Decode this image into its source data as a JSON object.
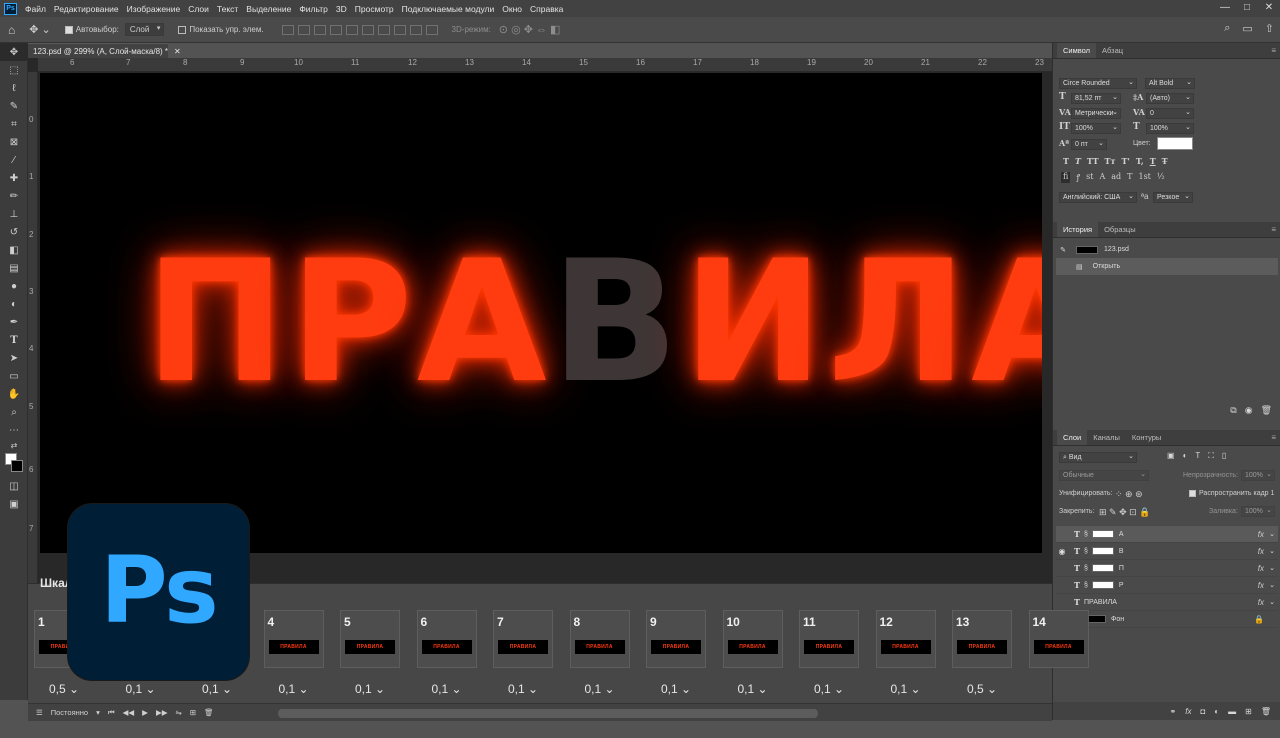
{
  "app": {
    "logo": "Ps"
  },
  "menu": [
    "Файл",
    "Редактирование",
    "Изображение",
    "Слои",
    "Текст",
    "Выделение",
    "Фильтр",
    "3D",
    "Просмотр",
    "Подключаемые модули",
    "Окно",
    "Справка"
  ],
  "window_buttons": [
    "—",
    "□",
    "✕"
  ],
  "options": {
    "auto_select_label": "Автовыбор:",
    "auto_select_value": "Слой",
    "show_transform_label": "Показать упр. элем.",
    "mode_3d_label": "3D-режим:"
  },
  "document": {
    "tab_title": "123.psd @ 299% (А, Слой-маска/8) *",
    "ruler_top": [
      "6",
      "7",
      "8",
      "9",
      "10",
      "11",
      "12",
      "13",
      "14",
      "15",
      "16",
      "17",
      "18",
      "19",
      "20",
      "21",
      "22",
      "23"
    ],
    "ruler_left": [
      "0",
      "1",
      "2",
      "3",
      "4",
      "5",
      "6",
      "7"
    ]
  },
  "canvas": {
    "letters": [
      {
        "ch": "П",
        "state": "on"
      },
      {
        "ch": "Р",
        "state": "on"
      },
      {
        "ch": "А",
        "state": "on"
      },
      {
        "ch": "В",
        "state": "off"
      },
      {
        "ch": "И",
        "state": "on"
      },
      {
        "ch": "Л",
        "state": "on"
      },
      {
        "ch": "А",
        "state": "on"
      }
    ],
    "glow_color": "#ff3c10"
  },
  "character_panel": {
    "tabs": [
      "Символ",
      "Абзац"
    ],
    "font_family": "Circe Rounded",
    "font_style": "Alt Bold",
    "font_size": "81,52 пт",
    "leading": "(Авто)",
    "kerning": "Метрически",
    "tracking": "0",
    "vscale": "100%",
    "hscale": "100%",
    "baseline": "0 пт",
    "color_label": "Цвет:",
    "language": "Английский: США",
    "aa": "Резкое",
    "style_glyphs": [
      "T",
      "T",
      "TT",
      "Tт",
      "T'",
      "T,",
      "T",
      "T̶"
    ],
    "ot_glyphs": [
      "fi",
      "ꝭ",
      "st",
      "A",
      "ad",
      "T",
      "1st",
      "½"
    ]
  },
  "history_panel": {
    "tabs": [
      "История",
      "Образцы"
    ],
    "items": [
      "123.psd",
      "Открыть"
    ]
  },
  "layers_panel": {
    "tabs": [
      "Слои",
      "Каналы",
      "Контуры"
    ],
    "filter": "Вид",
    "blend_mode": "Обычные",
    "opacity_label": "Непрозрачность:",
    "opacity_value": "100%",
    "unify_label": "Унифицировать:",
    "propagate_label": "Распространить кадр 1",
    "lock_label": "Закрепить:",
    "fill_label": "Заливка:",
    "fill_value": "100%",
    "layers": [
      {
        "name": "А",
        "type": "text",
        "visible": false,
        "mask": true,
        "fx": true,
        "selected": true
      },
      {
        "name": "В",
        "type": "text",
        "visible": true,
        "mask": true,
        "fx": true
      },
      {
        "name": "П",
        "type": "text",
        "visible": false,
        "mask": true,
        "fx": true
      },
      {
        "name": "Р",
        "type": "text",
        "visible": false,
        "mask": true,
        "fx": true
      },
      {
        "name": "ПРАВИЛА",
        "type": "text",
        "visible": false,
        "mask": false,
        "fx": true
      },
      {
        "name": "Фон",
        "type": "image",
        "visible": true,
        "mask": false,
        "fx": false,
        "locked": true
      }
    ],
    "bottom_icons": [
      "link-icon",
      "fx-icon",
      "mask-icon",
      "adjustment-icon",
      "folder-icon",
      "new-layer-icon",
      "trash-icon"
    ]
  },
  "timeline": {
    "title": "Шкала времени",
    "frames": [
      {
        "num": "1",
        "delay": "0,5 ⌄"
      },
      {
        "num": "2",
        "delay": "0,1 ⌄"
      },
      {
        "num": "3",
        "delay": "0,1 ⌄"
      },
      {
        "num": "4",
        "delay": "0,1 ⌄"
      },
      {
        "num": "5",
        "delay": "0,1 ⌄"
      },
      {
        "num": "6",
        "delay": "0,1 ⌄"
      },
      {
        "num": "7",
        "delay": "0,1 ⌄"
      },
      {
        "num": "8",
        "delay": "0,1 ⌄"
      },
      {
        "num": "9",
        "delay": "0,1 ⌄"
      },
      {
        "num": "10",
        "delay": "0,1 ⌄"
      },
      {
        "num": "11",
        "delay": "0,1 ⌄"
      },
      {
        "num": "12",
        "delay": "0,1 ⌄"
      },
      {
        "num": "13",
        "delay": "0,5 ⌄"
      },
      {
        "num": "14",
        "delay": ""
      }
    ],
    "loop_label": "Постоянно",
    "thumb_text": "ПРАВИЛА"
  }
}
